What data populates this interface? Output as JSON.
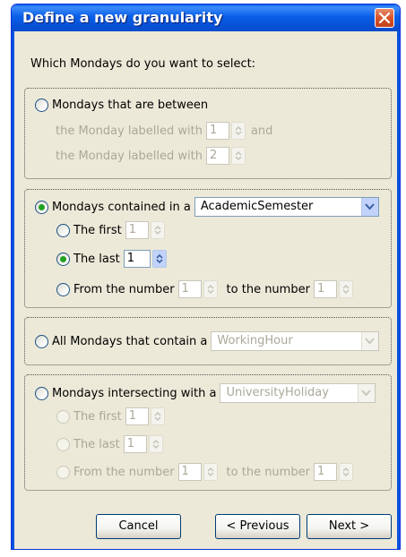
{
  "window": {
    "title": "Define a new granularity"
  },
  "question": "Which Mondays do you want to select:",
  "group_between": {
    "option_label": "Mondays that are between",
    "line1_label": "the Monday labelled with",
    "line1_value": "1",
    "and_label": "and",
    "line2_label": "the Monday labelled with",
    "line2_value": "2"
  },
  "group_contained": {
    "option_label": "Mondays contained in a",
    "combo_value": "AcademicSemester",
    "first_label": "The first",
    "first_value": "1",
    "last_label": "The last",
    "last_value": "1",
    "from_label": "From the number",
    "from_value": "1",
    "to_label": "to the number",
    "to_value": "1"
  },
  "group_contain": {
    "option_label": "All Mondays that contain a",
    "combo_value": "WorkingHour"
  },
  "group_intersect": {
    "option_label": "Mondays intersecting with a",
    "combo_value": "UniversityHoliday",
    "first_label": "The first",
    "first_value": "1",
    "last_label": "The last",
    "last_value": "1",
    "from_label": "From the number",
    "from_value": "1",
    "to_label": "to the number",
    "to_value": "1"
  },
  "buttons": {
    "cancel": "Cancel",
    "previous": "< Previous",
    "next": "Next >"
  },
  "colors": {
    "titlebar": "#0a5fe8",
    "dialog_bg": "#ece9d8",
    "selected_radio": "#21a121",
    "disabled_text": "#aca899"
  }
}
